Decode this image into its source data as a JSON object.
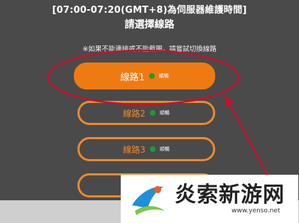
{
  "header": {
    "maintenance_text": "[07:00-07:20(GMT+8)為伺服器維護時間]",
    "title": "請選擇線路"
  },
  "notice": "※如果不能連接或不能截圖，請嘗試切換線路",
  "routes": [
    {
      "label": "線路1",
      "status": "順暢",
      "selected": true
    },
    {
      "label": "線路2",
      "status": "順暢",
      "selected": false
    },
    {
      "label": "線路3",
      "status": "順暢",
      "selected": false
    },
    {
      "label": "",
      "status": "",
      "selected": false
    }
  ],
  "watermark": {
    "brand": "炎索新游网",
    "url": "www.yenso.net"
  },
  "colors": {
    "background": "#4a4a4a",
    "accent": "#f07a12",
    "status_dot": "#1f9a2f",
    "annotation": "#c8102e"
  }
}
